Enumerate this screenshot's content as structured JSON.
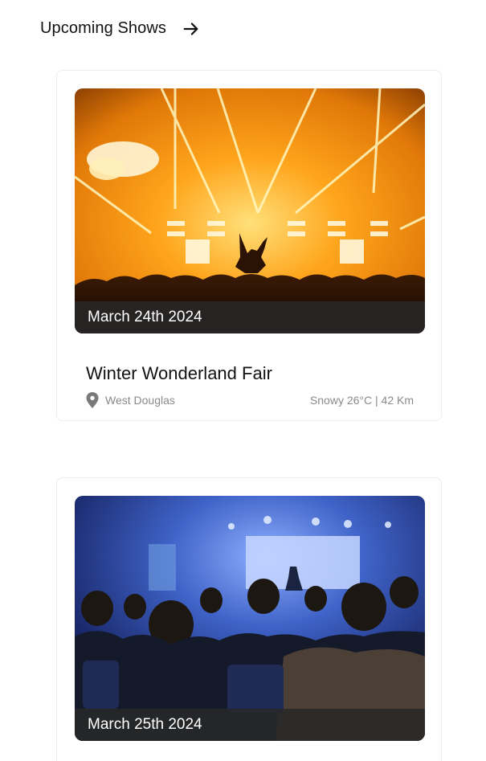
{
  "header": {
    "title": "Upcoming Shows",
    "arrow_icon": "arrow-right-icon"
  },
  "shows": [
    {
      "date": "March 24th 2024",
      "title": "Winter Wonderland Fair",
      "location": "West Douglas",
      "weather": "Snowy 26°C | 42 Km",
      "location_icon": "map-pin-icon"
    },
    {
      "date": "March 25th 2024"
    }
  ],
  "colors": {
    "pin": "#7a7a7a",
    "date_bar": "#282828"
  }
}
